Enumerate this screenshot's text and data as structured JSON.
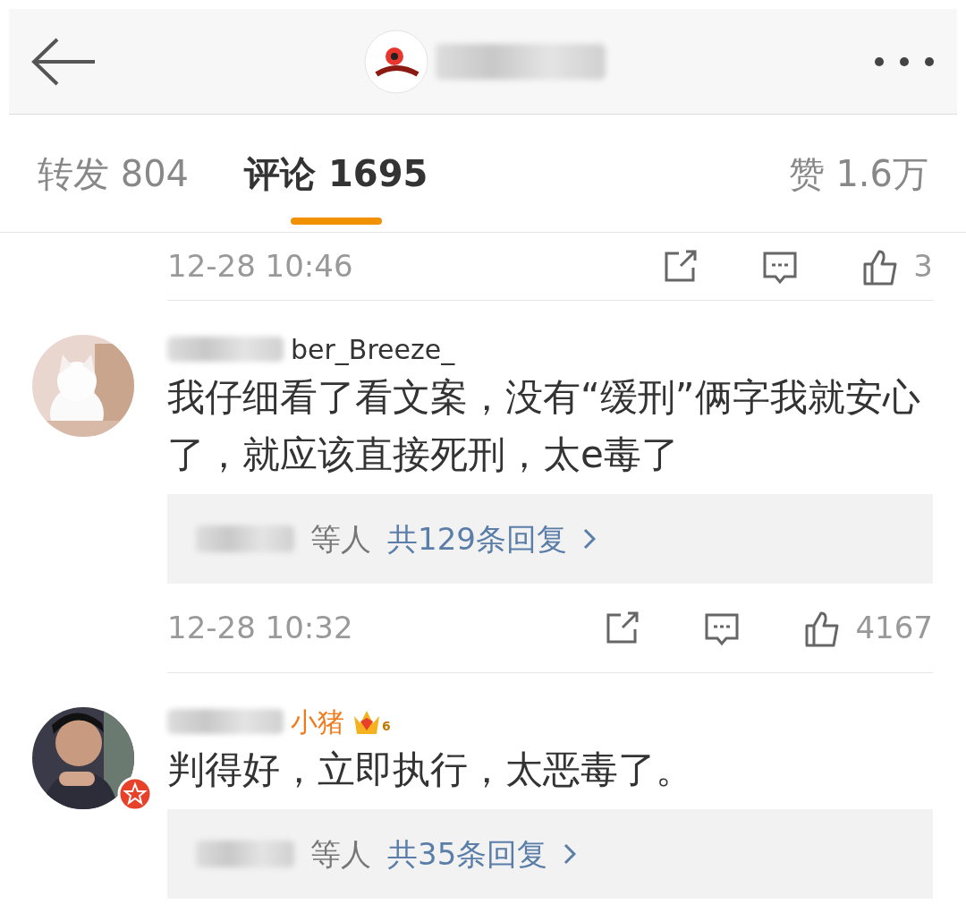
{
  "tabs": [
    {
      "label": "转发",
      "count": "804",
      "selected": false
    },
    {
      "label": "评论",
      "count": "1695",
      "selected": true
    },
    {
      "label": "赞",
      "count": "1.6万",
      "selected": false
    }
  ],
  "partial_footer": {
    "time": "12-28 10:46",
    "likes": "3"
  },
  "comments": [
    {
      "name": "ber_Breeze_",
      "verified": false,
      "text": "我仔细看了看文案，没有“缓刑”俩字我就安心了，就应该直接死刑，太e毒了",
      "replies_by": "等人",
      "replies": "共129条回复",
      "time": "12-28 10:32",
      "likes": "4167"
    },
    {
      "name": "小猪",
      "vip_level": "6",
      "verified": true,
      "text": "判得好，立即执行，太恶毒了。",
      "replies_by": "等人",
      "replies": "共35条回复"
    }
  ]
}
